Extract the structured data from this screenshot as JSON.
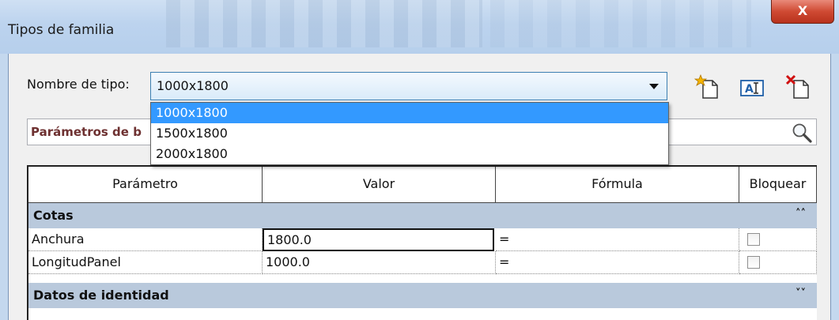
{
  "window": {
    "title": "Tipos de familia",
    "close_label": "X"
  },
  "type_selector": {
    "label": "Nombre de tipo:",
    "value": "1000x1800",
    "options": [
      "1000x1800",
      "1500x1800",
      "2000x1800"
    ],
    "selected_index": 0
  },
  "toolbar": {
    "new_type_icon": "new-type-icon",
    "rename_type_icon": "rename-type-icon",
    "delete_type_icon": "delete-type-icon"
  },
  "search": {
    "placeholder": "Parámetros de b",
    "icon": "magnifier-icon"
  },
  "grid": {
    "columns": [
      "Parámetro",
      "Valor",
      "Fórmula",
      "Bloquear"
    ],
    "groups": [
      {
        "name": "Cotas",
        "chevron": "⌃",
        "rows": [
          {
            "param": "Anchura",
            "value": "1800.0",
            "formula": "=",
            "locked": false
          },
          {
            "param": "LongitudPanel",
            "value": "1000.0",
            "formula": "=",
            "locked": false
          }
        ]
      },
      {
        "name": "Datos de identidad",
        "chevron": "⌄",
        "rows": []
      }
    ]
  },
  "colors": {
    "selection": "#3399ff",
    "group_header": "#b9c9dc",
    "close_button": "#cf4a33"
  }
}
